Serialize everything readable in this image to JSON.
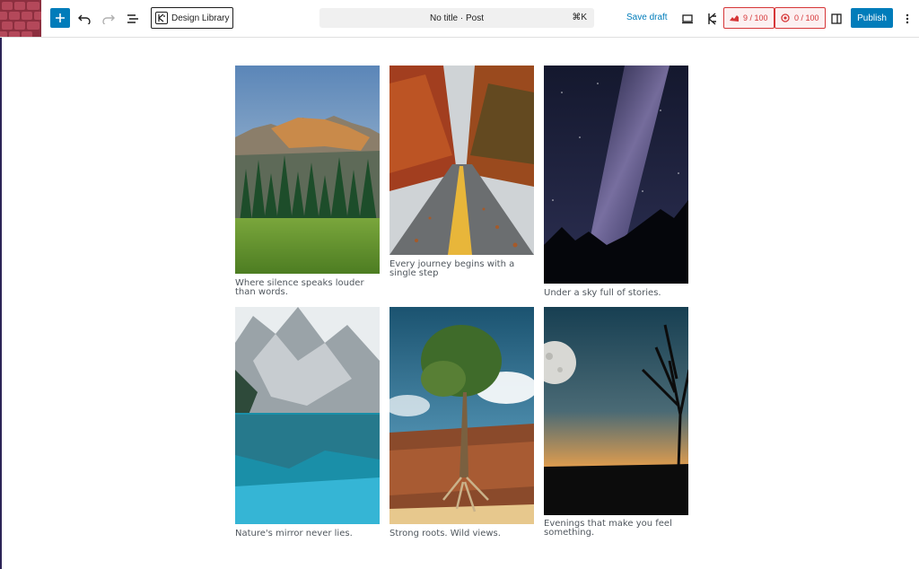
{
  "toolbar": {
    "design_library_label": "Design Library",
    "document_title": "No title · Post",
    "command_shortcut": "⌘K",
    "save_draft_label": "Save draft",
    "seo_score": "9 / 100",
    "readability_score": "0 / 100",
    "publish_label": "Publish"
  },
  "gallery": {
    "captions": [
      "Where silence speaks louder than words.",
      "Every journey begins with a single step",
      "Under a sky full of stories.",
      "Nature's mirror never lies.",
      "Strong roots. Wild views.",
      "Evenings that make you feel something."
    ]
  },
  "colors": {
    "accent": "#007cba",
    "score_red": "#d63638",
    "logo": "#8c2f3f"
  },
  "icons": [
    "plus-icon",
    "undo-icon",
    "redo-icon",
    "list-view-icon",
    "desktop-preview-icon",
    "stackable-icon",
    "sidebar-toggle-icon",
    "more-options-icon"
  ]
}
